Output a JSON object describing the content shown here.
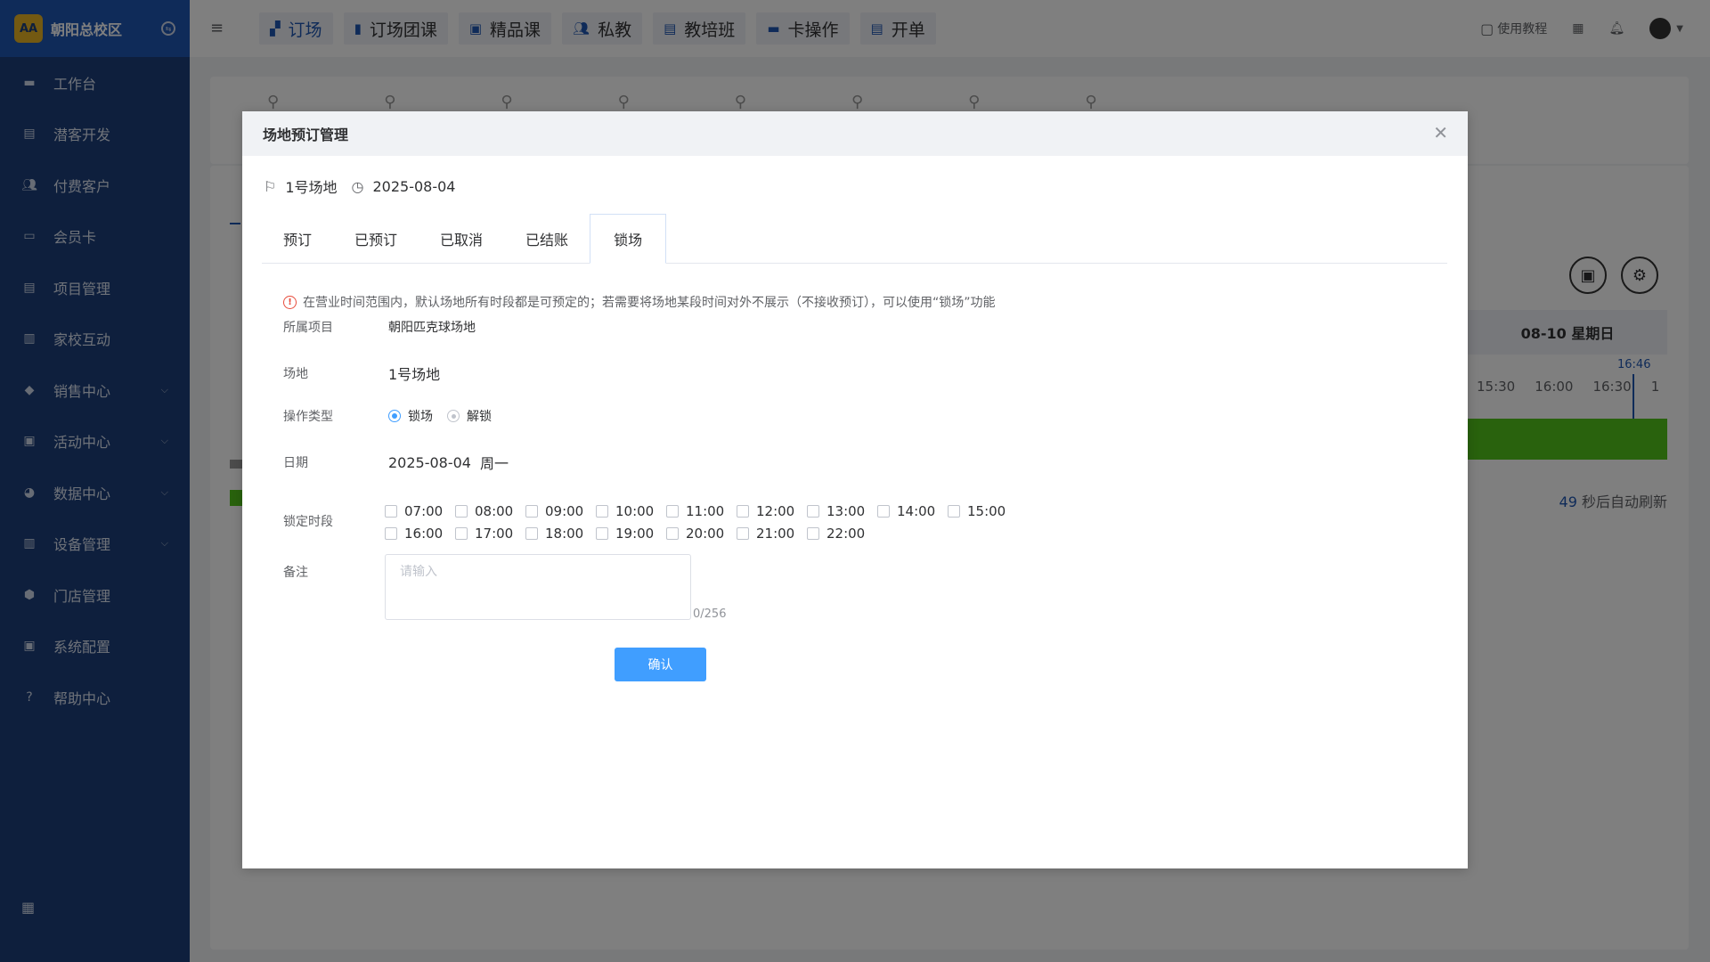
{
  "sidebar": {
    "title": "朝阳总校区",
    "logo_text": "AA",
    "items": [
      {
        "label": "工作台",
        "icon": "dashboard-icon",
        "arrow": false
      },
      {
        "label": "潜客开发",
        "icon": "id-card-icon",
        "arrow": false
      },
      {
        "label": "付费客户",
        "icon": "users-icon",
        "arrow": false
      },
      {
        "label": "会员卡",
        "icon": "card-icon",
        "arrow": false
      },
      {
        "label": "项目管理",
        "icon": "folder-icon",
        "arrow": false
      },
      {
        "label": "家校互动",
        "icon": "contact-book-icon",
        "arrow": false
      },
      {
        "label": "销售中心",
        "icon": "tag-icon",
        "arrow": true
      },
      {
        "label": "活动中心",
        "icon": "calendar-icon",
        "arrow": true
      },
      {
        "label": "数据中心",
        "icon": "pie-chart-icon",
        "arrow": true
      },
      {
        "label": "设备管理",
        "icon": "device-icon",
        "arrow": true
      },
      {
        "label": "门店管理",
        "icon": "store-icon",
        "arrow": false
      },
      {
        "label": "系统配置",
        "icon": "monitor-icon",
        "arrow": false
      },
      {
        "label": "帮助中心",
        "icon": "help-icon",
        "arrow": false
      }
    ]
  },
  "topbar": {
    "tabs": [
      "订场",
      "订场团课",
      "精品课",
      "私教",
      "教培班",
      "卡操作",
      "开单"
    ],
    "tutorial": "使用教程"
  },
  "background": {
    "date_header": "08-10 星期日",
    "now_time": "16:46",
    "times": [
      "15:30",
      "16:00",
      "16:30",
      "1"
    ],
    "refresh_seconds": "49",
    "refresh_text": "秒后自动刷新"
  },
  "dialog": {
    "title": "场地预订管理",
    "venue": "1号场地",
    "date": "2025-08-04",
    "tabs": [
      "预订",
      "已预订",
      "已取消",
      "已结账",
      "锁场"
    ],
    "notice": "在营业时间范围内，默认场地所有时段都是可预定的；若需要将场地某段时间对外不展示（不接收预订），可以使用“锁场”功能",
    "project_label": "所属项目",
    "project_value": "朝阳匹克球场地",
    "venue_label": "场地",
    "venue_value": "1号场地",
    "op_label": "操作类型",
    "op_lock": "锁场",
    "op_unlock": "解锁",
    "date_label": "日期",
    "date_value": "2025-08-04",
    "weekday": "周一",
    "slot_label": "锁定时段",
    "slots": [
      "07:00",
      "08:00",
      "09:00",
      "10:00",
      "11:00",
      "12:00",
      "13:00",
      "14:00",
      "15:00",
      "16:00",
      "17:00",
      "18:00",
      "19:00",
      "20:00",
      "21:00",
      "22:00"
    ],
    "remark_label": "备注",
    "remark_placeholder": "请输入",
    "remark_count": "0/256",
    "confirm": "确认"
  }
}
